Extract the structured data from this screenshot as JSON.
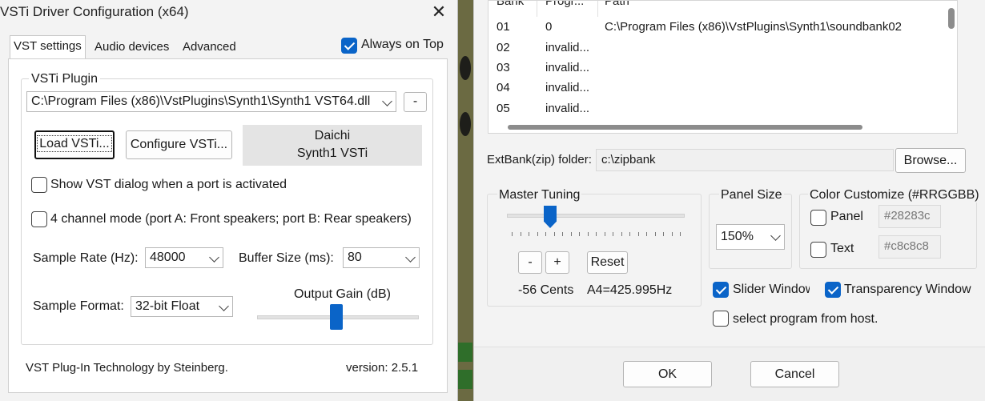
{
  "left_dialog": {
    "title": "VSTi Driver Configuration (x64)",
    "close_glyph": "✕",
    "tabs": [
      "VST settings",
      "Audio devices",
      "Advanced"
    ],
    "always_on_top": {
      "label": "Always on Top",
      "checked": true
    },
    "vsti_group_label": "VSTi Plugin",
    "plugin_path": "C:\\Program Files (x86)\\VstPlugins\\Synth1\\Synth1 VST64.dll",
    "remove_button": "-",
    "load_button": "Load VSTi...",
    "configure_button": "Configure VSTi...",
    "plugin_vendor": "Daichi",
    "plugin_name": "Synth1 VSTi",
    "show_vst_dialog": {
      "label": "Show VST dialog when a port is activated",
      "checked": false
    },
    "four_channel": {
      "label": "4 channel mode (port A: Front speakers; port B: Rear speakers)",
      "checked": false
    },
    "sample_rate_label": "Sample Rate (Hz):",
    "sample_rate_value": "48000",
    "buffer_size_label": "Buffer Size (ms):",
    "buffer_size_value": "80",
    "output_gain_label": "Output Gain (dB)",
    "output_gain_level": 0.49,
    "sample_format_label": "Sample Format:",
    "sample_format_value": "32-bit Float",
    "footer_left": "VST Plug-In Technology by Steinberg.",
    "footer_right": "version: 2.5.1"
  },
  "right_dialog": {
    "columns": [
      "Bank",
      "Progr...",
      "Path"
    ],
    "rows": [
      {
        "bank": "01",
        "program": "0",
        "path": "C:\\Program Files (x86)\\VstPlugins\\Synth1\\soundbank02"
      },
      {
        "bank": "02",
        "program": "invalid...",
        "path": ""
      },
      {
        "bank": "03",
        "program": "invalid...",
        "path": ""
      },
      {
        "bank": "04",
        "program": "invalid...",
        "path": ""
      },
      {
        "bank": "05",
        "program": "invalid...",
        "path": ""
      }
    ],
    "extbank_label": "ExtBank(zip) folder:",
    "extbank_value": "c:\\zipbank",
    "browse_button": "Browse...",
    "master_tuning_label": "Master Tuning",
    "tuning_minus": "-",
    "tuning_plus": "+",
    "tuning_reset": "Reset",
    "tuning_cents": "-56 Cents",
    "tuning_a4": "A4=425.995Hz",
    "panel_size_label": "Panel Size",
    "panel_size_value": "150%",
    "color_group_label": "Color Customize (#RRGGBB)",
    "panel_color": {
      "label": "Panel",
      "value": "#28283c",
      "checked": false
    },
    "text_color": {
      "label": "Text",
      "value": "#c8c8c8",
      "checked": false
    },
    "slider_window": {
      "label": "Slider Window",
      "checked": true
    },
    "transparency_window": {
      "label": "Transparency Window",
      "checked": true
    },
    "select_program": {
      "label": "select program from host.",
      "checked": false
    },
    "ok_button": "OK",
    "cancel_button": "Cancel"
  },
  "colors": {
    "accent": "#0a64c8",
    "dialog_bg": "#f3f3f3"
  }
}
